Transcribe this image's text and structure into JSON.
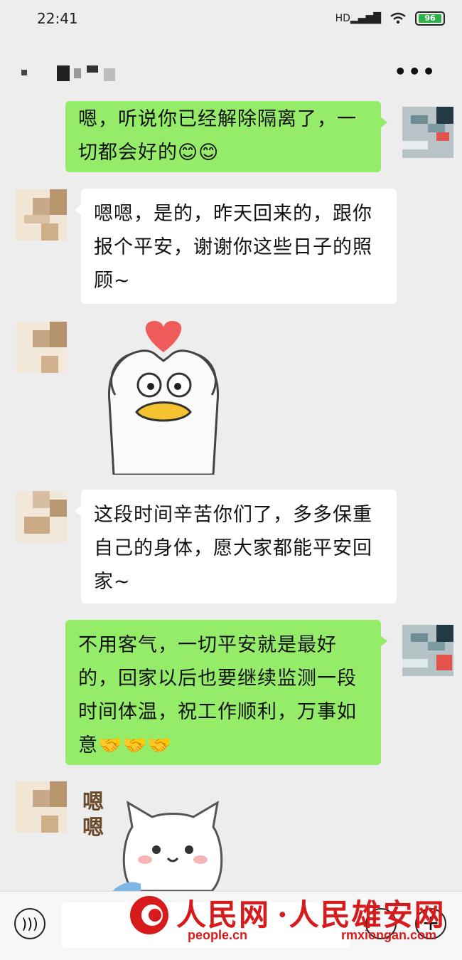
{
  "status_bar": {
    "time": "22:41",
    "network": "HD",
    "battery": "96"
  },
  "header": {
    "more_label": "•••"
  },
  "messages": [
    {
      "from": "me",
      "text": "嗯，听说你已经解除隔离了，一切都会好的😊😊"
    },
    {
      "from": "them",
      "text": "嗯嗯，是的，昨天回来的，跟你报个平安，谢谢你这些日子的照顾~"
    },
    {
      "from": "them",
      "sticker": "duck-heart-sticker"
    },
    {
      "from": "them",
      "text": "这段时间辛苦你们了，多多保重自己的身体，愿大家都能平安回家~"
    },
    {
      "from": "me",
      "text": "不用客气，一切平安就是最好的，回家以后也要继续监测一段时间体温，祝工作顺利，万事如意🤝🤝🤝"
    },
    {
      "from": "them",
      "sticker": "cat-sticker",
      "sticker_text": "嗯嗯"
    }
  ],
  "watermark": {
    "brand1": "人民网",
    "brand1_url": "people.cn",
    "brand2": "·人民雄安网",
    "brand2_url": "rmxiongan.com"
  },
  "colors": {
    "me_bubble": "#95ec69",
    "them_bubble": "#ffffff",
    "background": "#ededed",
    "watermark_red": "#d71a1b"
  },
  "icons": {
    "voice": "voice-icon",
    "emoji": "emoji-icon",
    "more": "plus-icon",
    "menu": "more-dots-icon"
  }
}
